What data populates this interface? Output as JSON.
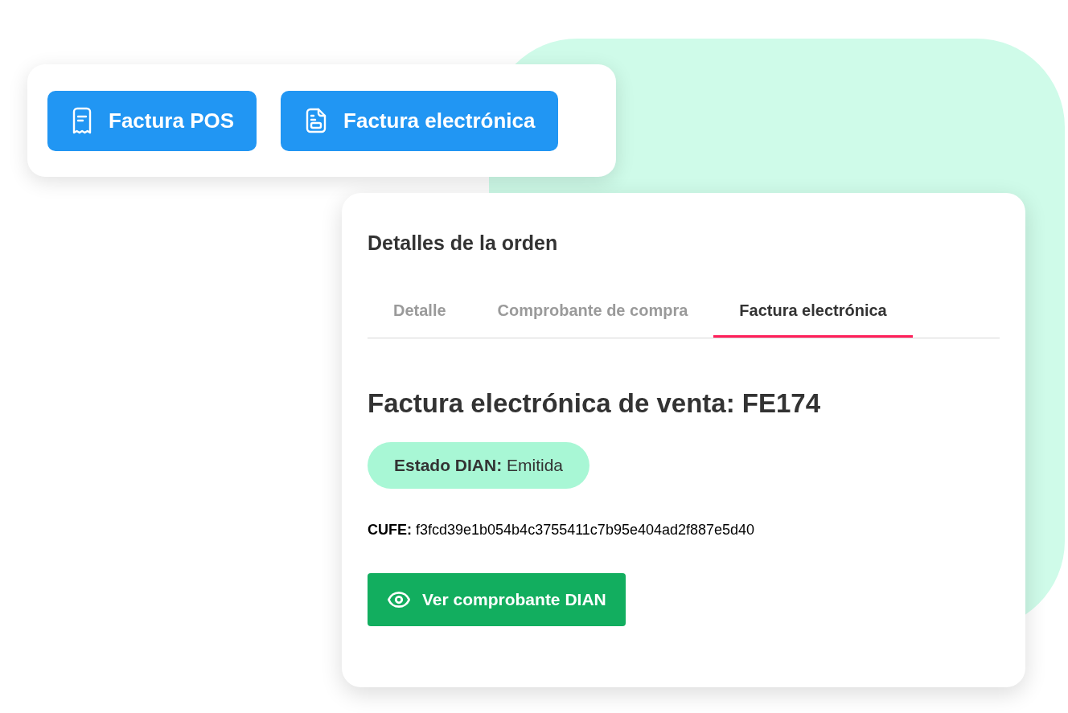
{
  "invoice_buttons": [
    {
      "label": "Factura POS",
      "kind": "receipt"
    },
    {
      "label": "Factura electrónica",
      "kind": "document"
    }
  ],
  "order_card": {
    "title": "Detalles de la orden",
    "tabs": [
      {
        "label": "Detalle",
        "selected": false
      },
      {
        "label": "Comprobante de compra",
        "selected": false
      },
      {
        "label": "Factura electrónica",
        "selected": true
      }
    ],
    "heading": "Factura electrónica de venta: FE174",
    "status": "**Estado DIAN:** Emitida",
    "cufe": "**CUFE:** f3fcd39e1b054b4c3755411c7b95e404ad2f887e5d40",
    "action_button": "Ver comprobante DIAN"
  }
}
